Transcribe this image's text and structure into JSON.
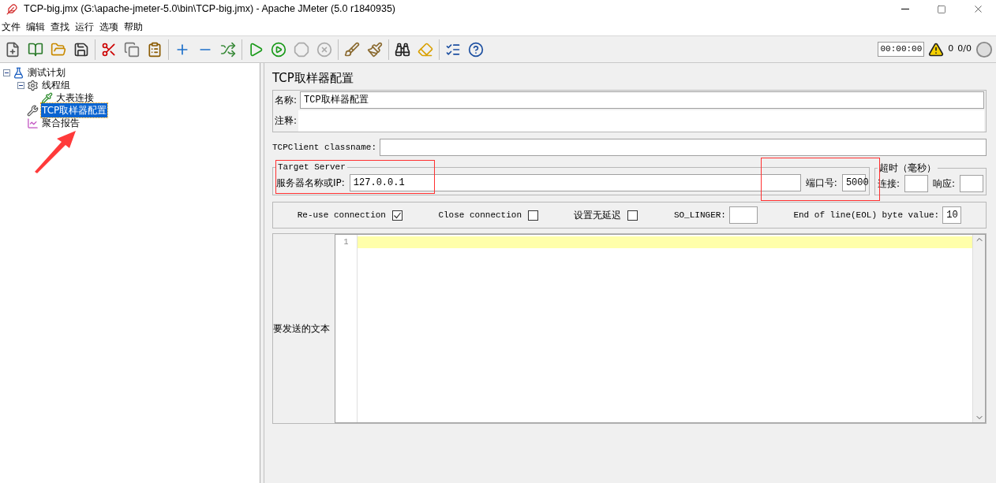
{
  "window": {
    "title": "TCP-big.jmx (G:\\apache-jmeter-5.0\\bin\\TCP-big.jmx) - Apache JMeter (5.0 r1840935)"
  },
  "menu": [
    "文件",
    "编辑",
    "查找",
    "运行",
    "选项",
    "帮助"
  ],
  "toolbar": {
    "timer": "00:00:00",
    "warnings": "0",
    "threads": "0/0"
  },
  "tree": [
    {
      "label": "测试计划",
      "kind": "plan",
      "expanded": true,
      "selected": false,
      "children": [
        {
          "label": "线程组",
          "kind": "threads",
          "expanded": true,
          "selected": false,
          "children": [
            {
              "label": "大表连接",
              "kind": "sampler",
              "selected": false
            }
          ]
        },
        {
          "label": "TCP取样器配置",
          "kind": "config",
          "selected": true
        },
        {
          "label": "聚合报告",
          "kind": "report",
          "selected": false
        }
      ]
    }
  ],
  "panel": {
    "title": "TCP取样器配置",
    "name_label": "名称:",
    "name_value": "TCP取样器配置",
    "comment_label": "注释:",
    "classname_label": "TCPClient classname:",
    "target_server": {
      "legend": "Target Server",
      "host_label": "服务器名称或IP:",
      "host_value": "127.0.0.1",
      "port_label": "端口号:",
      "port_value": "5000"
    },
    "timeout": {
      "legend": "超时（毫秒）",
      "connect_label": "连接:",
      "response_label": "响应:"
    },
    "options": [
      {
        "kind": "checkbox",
        "label": "Re-use connection",
        "checked": true
      },
      {
        "kind": "checkbox",
        "label": "Close connection",
        "checked": false
      },
      {
        "kind": "checkbox",
        "label": "设置无延迟",
        "checked": false
      },
      {
        "kind": "field",
        "label": "SO_LINGER:"
      },
      {
        "kind": "field",
        "label": "End of line(EOL) byte value:",
        "value": "10"
      }
    ],
    "text_label": "要发送的文本",
    "line_numbers": [
      "1"
    ]
  }
}
